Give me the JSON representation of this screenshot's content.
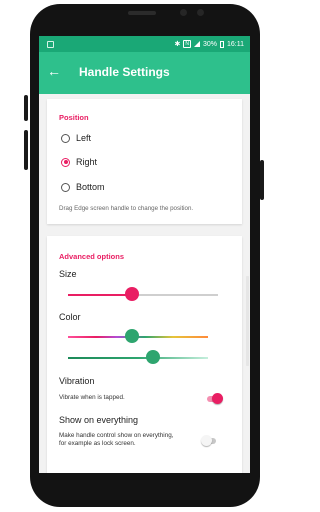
{
  "status_bar": {
    "bluetooth": "bluetooth-icon",
    "nfc": "nfc-icon",
    "battery_text": "30%",
    "time": "16:11"
  },
  "app_bar": {
    "back_icon": "arrow-left-icon",
    "title": "Handle Settings",
    "color": "#2ec08c"
  },
  "position_section": {
    "title": "Position",
    "options": [
      {
        "label": "Left",
        "selected": false
      },
      {
        "label": "Right",
        "selected": true
      },
      {
        "label": "Bottom",
        "selected": false
      }
    ],
    "hint": "Drag Edge screen handle to change the position."
  },
  "advanced_section": {
    "title": "Advanced options",
    "size_label": "Size",
    "size_value": 0.42,
    "color_label": "Color",
    "color_hue_value": 0.42,
    "color_shade_value": 0.58,
    "vibration_label": "Vibration",
    "vibration_desc": "Vibrate when is tapped.",
    "vibration_on": true,
    "show_label": "Show on everything",
    "show_desc_line1": "Make handle control show on everything,",
    "show_desc_line2": "for example as lock screen.",
    "show_on": false
  },
  "colors": {
    "accent": "#e91e63",
    "green": "#2ea56f"
  }
}
